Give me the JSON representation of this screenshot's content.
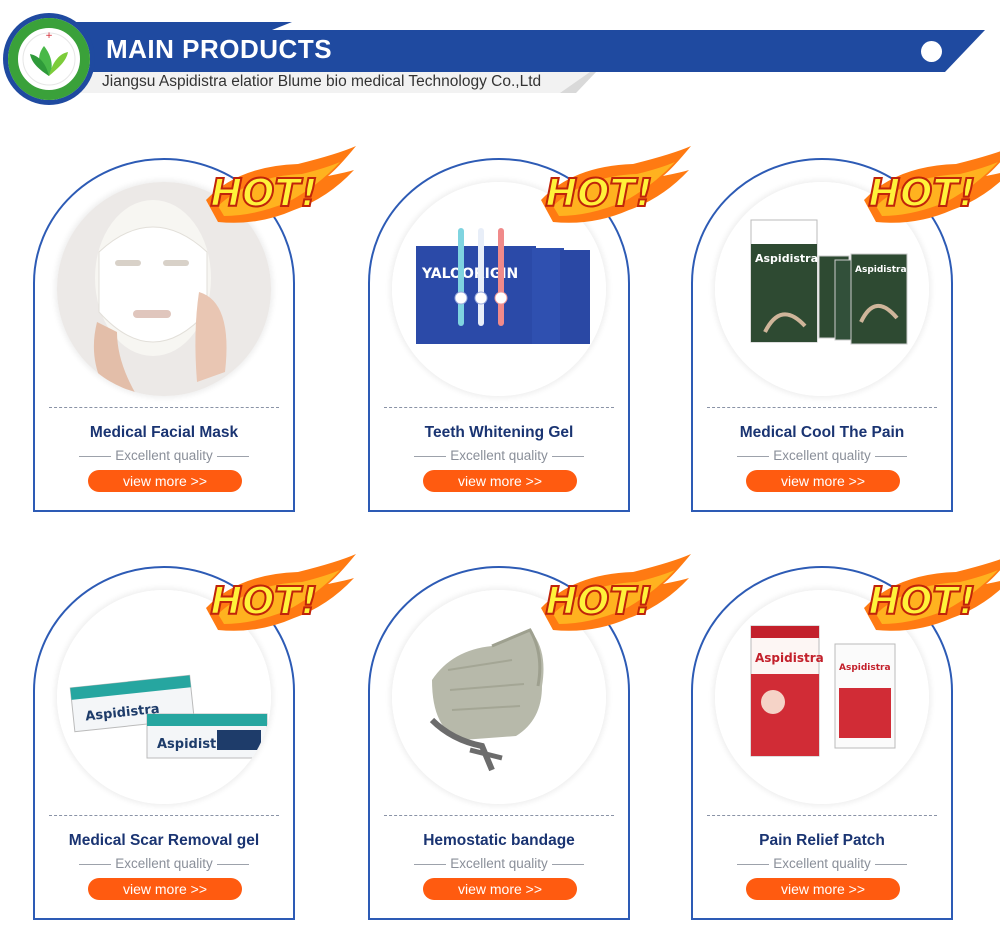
{
  "header": {
    "title": "MAIN PRODUCTS",
    "subtitle": "Jiangsu Aspidistra elatior Blume bio medical Technology Co.,Ltd",
    "logo_alt": "Aspidistra Biotechnology logo"
  },
  "colors": {
    "brand_blue": "#1f4aa0",
    "button_orange": "#ff5b10",
    "title_navy": "#1a3472"
  },
  "products": [
    {
      "name": "Medical Facial Mask",
      "tagline": "Excellent quality",
      "button": "view more >>",
      "badge": "HOT!",
      "image": "facial-mask-photo"
    },
    {
      "name": "Teeth Whitening Gel",
      "tagline": "Excellent quality",
      "button": "view more >>",
      "badge": "HOT!",
      "image": "whitening-gel-photo",
      "image_text": "YALOORIGIN"
    },
    {
      "name": "Medical Cool The Pain",
      "tagline": "Excellent quality",
      "button": "view more >>",
      "badge": "HOT!",
      "image": "cool-pain-patch-photo",
      "image_text": "Aspidistra"
    },
    {
      "name": "Medical Scar Removal gel",
      "tagline": "Excellent quality",
      "button": "view more >>",
      "badge": "HOT!",
      "image": "scar-gel-photo",
      "image_text": "Aspidistra"
    },
    {
      "name": "Hemostatic bandage",
      "tagline": "Excellent quality",
      "button": "view more >>",
      "badge": "HOT!",
      "image": "bandage-photo"
    },
    {
      "name": "Pain Relief Patch",
      "tagline": "Excellent quality",
      "button": "view more >>",
      "badge": "HOT!",
      "image": "pain-relief-patch-photo",
      "image_text": "Aspidistra"
    }
  ]
}
